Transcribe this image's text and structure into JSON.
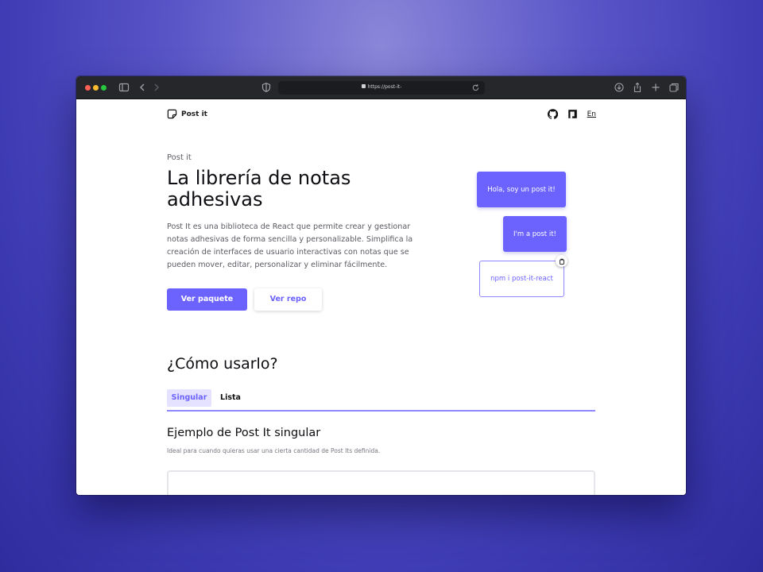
{
  "browser": {
    "url": "https://post-it-",
    "icons": {
      "sidebar": "sidebar-icon",
      "back": "chevron-left-icon",
      "forward": "chevron-right-icon",
      "shield": "shield-icon",
      "reload": "reload-icon",
      "download": "download-icon",
      "share": "share-icon",
      "new_tab": "plus-icon",
      "tabs": "tabs-overview-icon"
    }
  },
  "nav": {
    "logo_text": "Post it",
    "lang": "En",
    "icons": {
      "github": "github-icon",
      "npm": "npm-icon",
      "logo": "sticky-note-icon"
    }
  },
  "hero": {
    "eyebrow": "Post it",
    "title": "La librería de notas adhesivas",
    "description": "Post It es una biblioteca de React que permite crear y gestionar notas adhesivas de forma sencilla y personalizable. Simplifica la creación de interfaces de usuario interactivas con notas que se pueden mover, editar, personalizar y eliminar fácilmente.",
    "primary_button": "Ver paquete",
    "secondary_button": "Ver repo"
  },
  "notes": [
    {
      "text": "Hola, soy un post it!"
    },
    {
      "text": "I'm a post it!"
    },
    {
      "text": "npm i post-it-react"
    }
  ],
  "usage": {
    "title": "¿Cómo usarlo?",
    "tabs": [
      "Singular",
      "Lista"
    ],
    "active_tab": "Singular",
    "example_title": "Ejemplo de Post It singular",
    "example_description": "Ideal para cuando quieras usar una cierta cantidad de Post Its definida."
  },
  "colors": {
    "accent": "#6c63ff",
    "accent_light": "#e4e2ff",
    "background_gradient": "#4b48be"
  }
}
